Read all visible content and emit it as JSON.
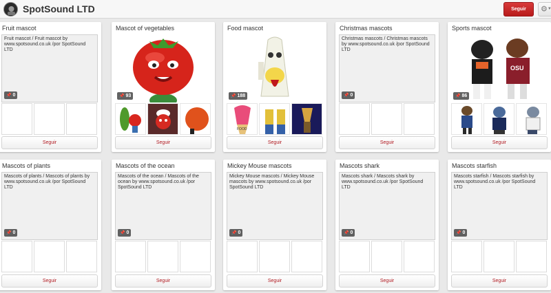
{
  "header": {
    "profile_name": "SpotSound LTD",
    "follow_all_label": "Seguir",
    "settings_icon": "gear-icon"
  },
  "colors": {
    "accent": "#c8232c",
    "follow_text": "#b0181f",
    "background": "#e9e9e9"
  },
  "boards": [
    {
      "title": "Fruit mascot",
      "description": "Fruit mascot / Fruit mascot by www.spotsound.co.uk /por SpotSound LTD",
      "pin_count": "0",
      "follow_label": "Seguir"
    },
    {
      "title": "Mascot of vegetables",
      "description": "",
      "pin_count": "93",
      "follow_label": "Seguir"
    },
    {
      "title": "Food mascot",
      "description": "",
      "pin_count": "188",
      "follow_label": "Seguir"
    },
    {
      "title": "Christmas mascots",
      "description": "Christmas mascots / Christmas mascots by www.spotsound.co.uk /por SpotSound LTD",
      "pin_count": "0",
      "follow_label": "Seguir"
    },
    {
      "title": "Sports mascot",
      "description": "",
      "pin_count": "86",
      "follow_label": "Seguir"
    },
    {
      "title": "Mascots of plants",
      "description": "Mascots of plants / Mascots of plants by www.spotsound.co.uk /por SpotSound LTD",
      "pin_count": "0",
      "follow_label": "Seguir"
    },
    {
      "title": "Mascots of the ocean",
      "description": "Mascots of the ocean / Mascots of the ocean by www.spotsound.co.uk /por SpotSound LTD",
      "pin_count": "0",
      "follow_label": "Seguir"
    },
    {
      "title": "Mickey Mouse mascots",
      "description": "Mickey Mouse mascots / Mickey Mouse mascots by www.spotsound.co.uk /por SpotSound LTD",
      "pin_count": "0",
      "follow_label": "Seguir"
    },
    {
      "title": "Mascots shark",
      "description": "Mascots shark / Mascots shark by www.spotsound.co.uk /por SpotSound LTD",
      "pin_count": "0",
      "follow_label": "Seguir"
    },
    {
      "title": "Mascots starfish",
      "description": "Mascots starfish / Mascots starfish by www.spotsound.co.uk /por SpotSound LTD",
      "pin_count": "0",
      "follow_label": "Seguir"
    }
  ]
}
